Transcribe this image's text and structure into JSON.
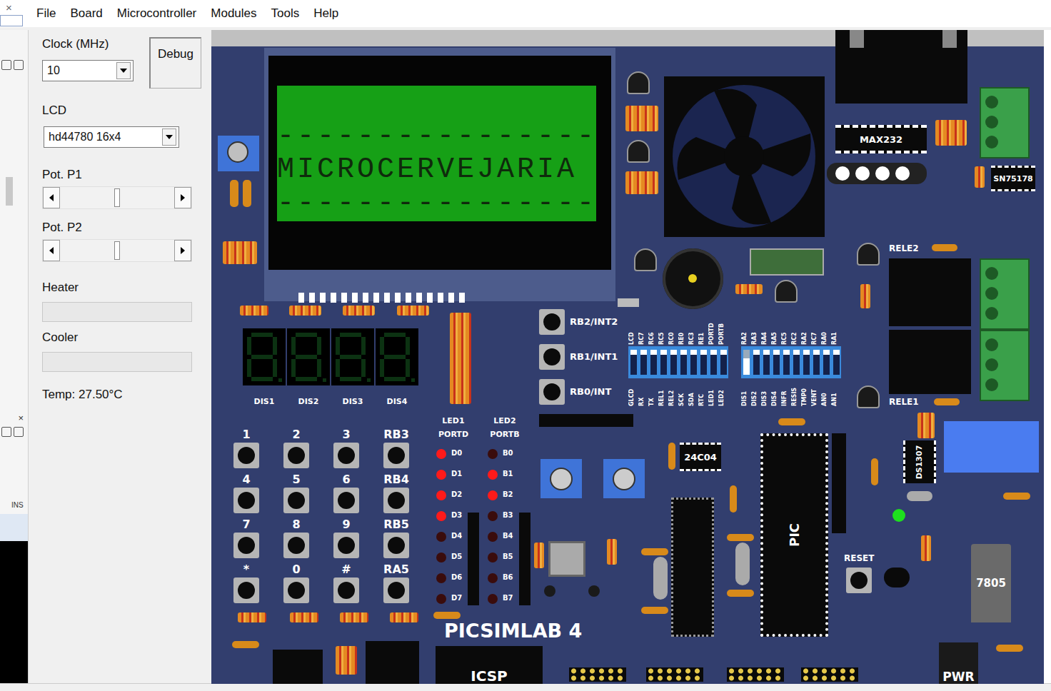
{
  "window": {
    "close": "×"
  },
  "menu": [
    "File",
    "Board",
    "Microcontroller",
    "Modules",
    "Tools",
    "Help"
  ],
  "side_strip": {
    "close": "×",
    "mode": "INS"
  },
  "controls": {
    "clock": {
      "label": "Clock (MHz)",
      "value": "10"
    },
    "debug": "Debug",
    "lcd": {
      "label": "LCD",
      "value": "hd44780 16x4"
    },
    "pots": [
      {
        "label": "Pot. P1",
        "level": 0.5
      },
      {
        "label": "Pot. P2",
        "level": 0.5
      }
    ],
    "bars": [
      {
        "label": "Heater",
        "level": 0
      },
      {
        "label": "Cooler",
        "level": 0
      }
    ],
    "temp": "Temp: 27.50°C"
  },
  "board": {
    "lcd_rows": [
      "",
      "----------------",
      "MICROCERVEJARIA",
      "----------------"
    ],
    "parts": {
      "max232": "MAX232",
      "sn75178": "SN75178",
      "rele2": "RELE2",
      "rele1": "RELE1",
      "eeprom": "24C04",
      "pic": "PIC",
      "rtc": "DS1307",
      "reset": "RESET",
      "regulator": "7805",
      "brand": "PICSIMLAB 4",
      "icsp": "ICSP",
      "pwr": "PWR"
    },
    "buttons": [
      {
        "label": "RB2/INT2"
      },
      {
        "label": "RB1/INT1"
      },
      {
        "label": "RB0/INT"
      }
    ],
    "displays": [
      {
        "label": "DIS1"
      },
      {
        "label": "DIS2"
      },
      {
        "label": "DIS3"
      },
      {
        "label": "DIS4"
      }
    ],
    "keypad": [
      "1",
      "2",
      "3",
      "RB3",
      "4",
      "5",
      "6",
      "RB4",
      "7",
      "8",
      "9",
      "RB5",
      "*",
      "0",
      "#",
      "RA5"
    ],
    "leds": [
      {
        "title": "LED1",
        "port": "PORTD",
        "items": [
          {
            "label": "D0",
            "on": true
          },
          {
            "label": "D1",
            "on": true
          },
          {
            "label": "D2",
            "on": true
          },
          {
            "label": "D3",
            "on": true
          },
          {
            "label": "D4",
            "on": false
          },
          {
            "label": "D5",
            "on": false
          },
          {
            "label": "D6",
            "on": false
          },
          {
            "label": "D7",
            "on": false
          }
        ]
      },
      {
        "title": "LED2",
        "port": "PORTB",
        "items": [
          {
            "label": "B0",
            "on": false
          },
          {
            "label": "B1",
            "on": true
          },
          {
            "label": "B2",
            "on": true
          },
          {
            "label": "B3",
            "on": false
          },
          {
            "label": "B4",
            "on": false
          },
          {
            "label": "B5",
            "on": false
          },
          {
            "label": "B6",
            "on": false
          },
          {
            "label": "B7",
            "on": false
          }
        ]
      }
    ],
    "dip": [
      {
        "switches": [
          {
            "top": "LCD",
            "bottom": "GLCD",
            "on": true
          },
          {
            "top": "RC7",
            "bottom": "RX",
            "on": true
          },
          {
            "top": "RC6",
            "bottom": "TX",
            "on": true
          },
          {
            "top": "RC5",
            "bottom": "REL1",
            "on": true
          },
          {
            "top": "RC0",
            "bottom": "REL2",
            "on": true
          },
          {
            "top": "RE0",
            "bottom": "SCK",
            "on": true
          },
          {
            "top": "RC3",
            "bottom": "SDA",
            "on": true
          },
          {
            "top": "RE1",
            "bottom": "RTC",
            "on": true
          },
          {
            "top": "PORTD",
            "bottom": "LED1",
            "on": true
          },
          {
            "top": "PORTB",
            "bottom": "LED2",
            "on": true
          }
        ]
      },
      {
        "switches": [
          {
            "top": "RA2",
            "bottom": "DIS1",
            "on": false
          },
          {
            "top": "RA3",
            "bottom": "DIS2",
            "on": true
          },
          {
            "top": "RA4",
            "bottom": "DIS3",
            "on": true
          },
          {
            "top": "RA5",
            "bottom": "DIS4",
            "on": true
          },
          {
            "top": "RC5",
            "bottom": "INFR",
            "on": true
          },
          {
            "top": "RC2",
            "bottom": "RESIS",
            "on": true
          },
          {
            "top": "RA2",
            "bottom": "TMP0",
            "on": true
          },
          {
            "top": "RC7",
            "bottom": "VENT",
            "on": true
          },
          {
            "top": "RA0",
            "bottom": "AN0",
            "on": true
          },
          {
            "top": "RA1",
            "bottom": "AN1",
            "on": true
          }
        ]
      }
    ]
  }
}
